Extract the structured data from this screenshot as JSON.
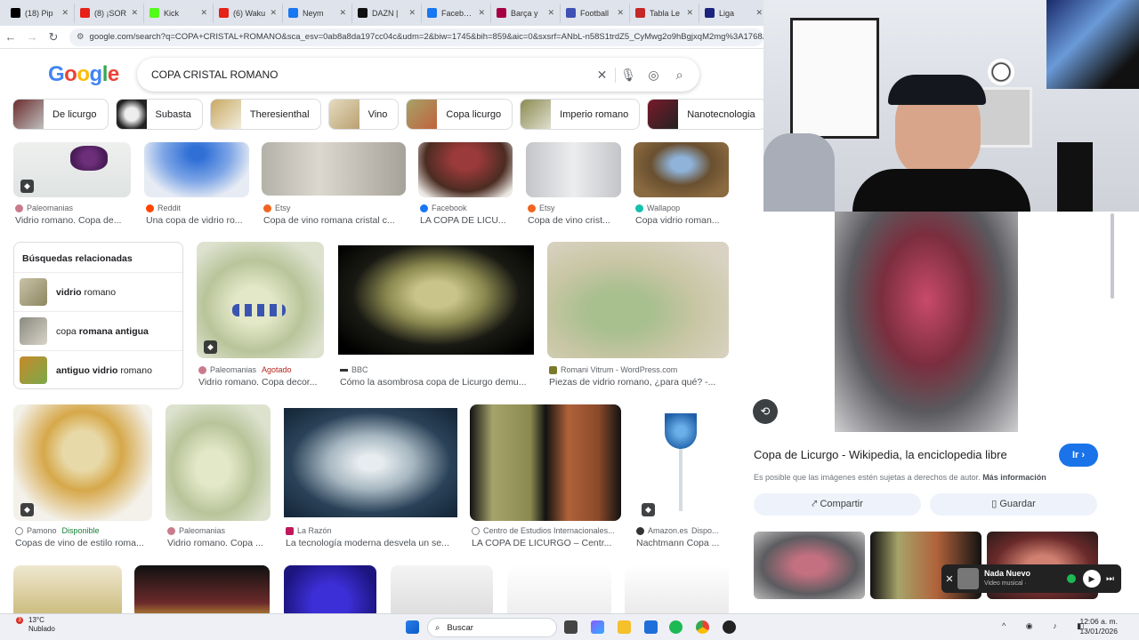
{
  "browser": {
    "tabs": [
      {
        "label": "(18) Pip",
        "color": "#000000"
      },
      {
        "label": "(8) ¡SOR",
        "color": "#e62117"
      },
      {
        "label": "Kick",
        "color": "#53fc18"
      },
      {
        "label": "(6) Waku",
        "color": "#e62117"
      },
      {
        "label": "Neym",
        "color": "#1877f2"
      },
      {
        "label": "DAZN |",
        "color": "#111111"
      },
      {
        "label": "Facebook",
        "color": "#1877f2"
      },
      {
        "label": "Barça y",
        "color": "#a50044"
      },
      {
        "label": "Football",
        "color": "#3f51b5"
      },
      {
        "label": "Tabla Le",
        "color": "#c62828"
      },
      {
        "label": "Liga",
        "color": "#1a237e"
      }
    ],
    "url": "google.com/search?q=COPA+CRISTAL+ROMANO&sca_esv=0ab8a8da197cc04c&udm=2&biw=1745&bih=859&aic=0&sxsrf=ANbL-n58S1trdZ5_CyMwg2o9hBgjxqM2mg%3A176828"
  },
  "search": {
    "logo": "Google",
    "query": "COPA CRISTAL ROMANO"
  },
  "chips": [
    "De licurgo",
    "Subasta",
    "Theresienthal",
    "Vino",
    "Copa licurgo",
    "Imperio romano",
    "Nanotecnologia"
  ],
  "results": {
    "row1": [
      {
        "source": "Paleomanias",
        "title": "Vidrio romano. Copa de..."
      },
      {
        "source": "Reddit",
        "title": "Una copa de vidrio ro..."
      },
      {
        "source": "Etsy",
        "title": "Copa de vino romana cristal c..."
      },
      {
        "source": "Facebook",
        "title": "LA COPA DE LICU..."
      },
      {
        "source": "Etsy",
        "title": "Copa de vino crist..."
      },
      {
        "source": "Wallapop",
        "title": "Copa vidrio roman..."
      }
    ],
    "related": {
      "heading": "Búsquedas relacionadas",
      "items": [
        {
          "bold": "vidrio",
          "rest": " romano"
        },
        {
          "pre": "copa ",
          "bold": "romana antigua"
        },
        {
          "bold": "antiguo vidrio",
          "rest": " romano"
        }
      ]
    },
    "row2": [
      {
        "source": "Paleomanias",
        "badge": "Agotado",
        "title": "Vidrio romano. Copa decor..."
      },
      {
        "source": "BBC",
        "title": "Cómo la asombrosa copa de Licurgo demu..."
      },
      {
        "source": "Romani Vitrum - WordPress.com",
        "title": "Piezas de vidrio romano, ¿para qué? -..."
      }
    ],
    "row3": [
      {
        "source": "Pamono",
        "badge": "Disponible",
        "title": "Copas de vino de estilo roma..."
      },
      {
        "source": "Paleomanias",
        "title": "Vidrio romano. Copa ..."
      },
      {
        "source": "La Razón",
        "title": "La tecnología moderna desvela un se..."
      },
      {
        "source": "Centro de Estudios Internacionales...",
        "title": "LA COPA DE LICURGO – Centr..."
      },
      {
        "source": "Amazon.es",
        "badge": "Dispo...",
        "title": "Nachtmann Copa ..."
      }
    ]
  },
  "panel": {
    "title": "Copa de Licurgo - Wikipedia, la enciclopedia libre",
    "go": "Ir",
    "note": "Es posible que las imágenes estén sujetas a derechos de autor.",
    "more": "Más información",
    "share": "Compartir",
    "save": "Guardar"
  },
  "player": {
    "track": "Nada Nuevo",
    "sub": "Video musical ·"
  },
  "taskbar": {
    "temp": "13°C",
    "weather": "Nublado",
    "search_placeholder": "Buscar",
    "time": "12:06 a. m.",
    "date": "13/01/2026"
  }
}
